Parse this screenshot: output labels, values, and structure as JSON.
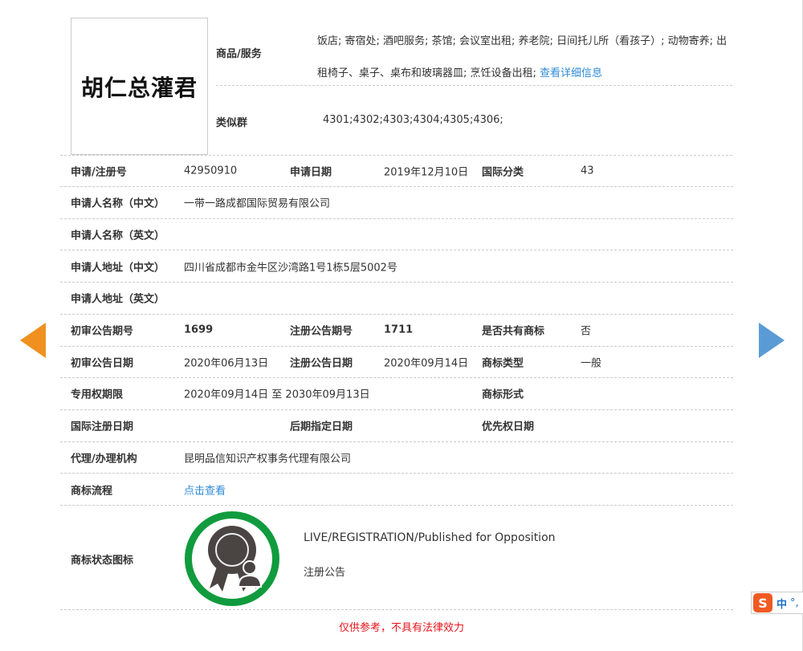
{
  "trademark": {
    "name": "胡仁总灌君"
  },
  "goods": {
    "label": "商品/服务",
    "text": "饭店; 寄宿处; 酒吧服务; 茶馆; 会议室出租; 养老院; 日间托儿所（看孩子）; 动物寄养; 出租椅子、桌子、桌布和玻璃器皿; 烹饪设备出租; ",
    "link": "查看详细信息"
  },
  "similar": {
    "label": "类似群",
    "value": "4301;4302;4303;4304;4305;4306;"
  },
  "rows": [
    {
      "l1": "申请/注册号",
      "v1": "42950910",
      "l2": "申请日期",
      "v2": "2019年12月10日",
      "l3": "国际分类",
      "v3": "43"
    },
    {
      "l1": "申请人名称（中文）",
      "v1": "一带一路成都国际贸易有限公司"
    },
    {
      "l1": "申请人名称（英文）",
      "v1": ""
    },
    {
      "l1": "申请人地址（中文）",
      "v1": "四川省成都市金牛区沙湾路1号1栋5层5002号"
    },
    {
      "l1": "申请人地址（英文）",
      "v1": ""
    },
    {
      "l1": "初审公告期号",
      "v1": "1699",
      "l2": "注册公告期号",
      "v2": "1711",
      "l3": "是否共有商标",
      "v3": "否"
    },
    {
      "l1": "初审公告日期",
      "v1": "2020年06月13日",
      "l2": "注册公告日期",
      "v2": "2020年09月14日",
      "l3": "商标类型",
      "v3": "一般"
    },
    {
      "l1": "专用权期限",
      "v1": "2020年09月14日 至 2030年09月13日",
      "l3": "商标形式",
      "v3": ""
    },
    {
      "l1": "国际注册日期",
      "v1": "",
      "l2": "后期指定日期",
      "v2": "",
      "l3": "优先权日期",
      "v3": ""
    },
    {
      "l1": "代理/办理机构",
      "v1": "昆明品信知识产权事务代理有限公司"
    },
    {
      "l1": "商标流程",
      "v1": "点击查看"
    }
  ],
  "status": {
    "label": "商标状态图标",
    "en": "LIVE/REGISTRATION/Published for Opposition",
    "cn": "注册公告"
  },
  "footer": "仅供参考，不具有法律效力",
  "ime": {
    "logo": "S",
    "lang": "中",
    "punct": "°,"
  },
  "colors": {
    "link": "#2e8bd8",
    "ring": "#119b3e",
    "prev": "#f0901e",
    "next": "#5b9bd5",
    "warn": "#e8141c"
  }
}
